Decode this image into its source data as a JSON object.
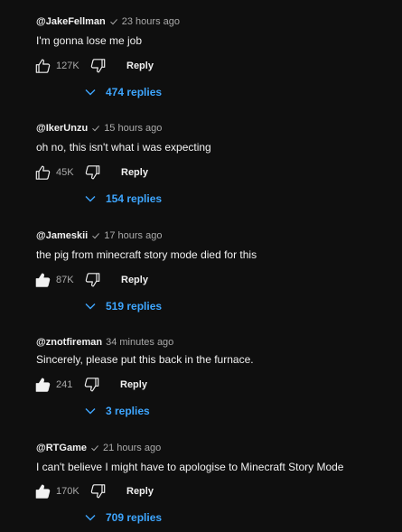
{
  "comments": [
    {
      "author": "@JakeFellman",
      "verified": true,
      "time": "23 hours ago",
      "text": "I'm gonna lose me job",
      "likes": "127K",
      "liked": false,
      "reply_label": "Reply",
      "replies": "474 replies"
    },
    {
      "author": "@IkerUnzu",
      "verified": true,
      "time": "15 hours ago",
      "text": "oh no, this isn't what i was expecting",
      "likes": "45K",
      "liked": false,
      "reply_label": "Reply",
      "replies": "154 replies"
    },
    {
      "author": "@Jameskii",
      "verified": true,
      "time": "17 hours ago",
      "text": "the pig from minecraft story mode died for this",
      "likes": "87K",
      "liked": true,
      "reply_label": "Reply",
      "replies": "519 replies"
    },
    {
      "author": "@znotfireman",
      "verified": false,
      "time": "34 minutes ago",
      "text": "Sincerely, please put this back in the furnace.",
      "likes": "241",
      "liked": true,
      "reply_label": "Reply",
      "replies": "3 replies"
    },
    {
      "author": "@RTGame",
      "verified": true,
      "time": "21 hours ago",
      "text": "I can't believe I might have to apologise to Minecraft Story Mode",
      "likes": "170K",
      "liked": true,
      "reply_label": "Reply",
      "replies": "709 replies"
    }
  ],
  "colors": {
    "background": "#0f0f0f",
    "text": "#f1f1f1",
    "secondary": "#aaaaaa",
    "link": "#3ea6ff"
  },
  "icons": {
    "like": "thumbs-up-icon",
    "dislike": "thumbs-down-icon",
    "verified": "check-icon",
    "expand": "chevron-down-icon"
  }
}
